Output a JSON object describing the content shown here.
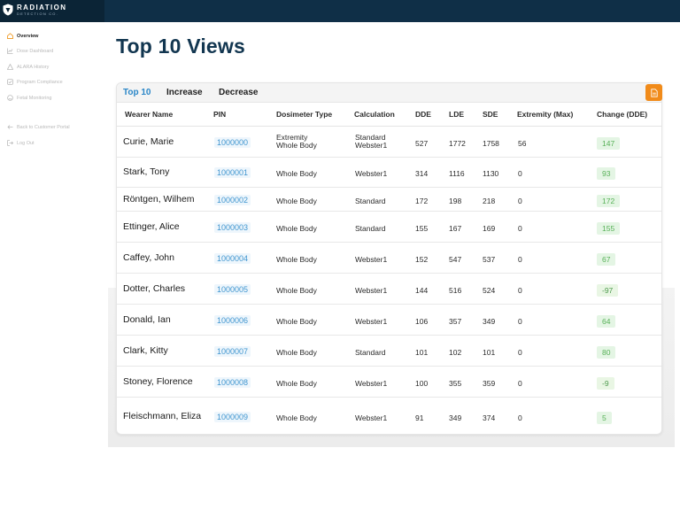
{
  "brand": {
    "line1": "RADIATION",
    "line2": "DETECTION CO."
  },
  "sidebar": {
    "items": [
      {
        "label": "Overview",
        "icon": "home-icon"
      },
      {
        "label": "Dose Dashboard",
        "icon": "chart-icon"
      },
      {
        "label": "ALARA History",
        "icon": "warning-icon"
      },
      {
        "label": "Program Compliance",
        "icon": "checklist-icon"
      },
      {
        "label": "Fetal Monitoring",
        "icon": "face-icon"
      },
      {
        "label": "Back to Customer Portal",
        "icon": "back-arrow-icon"
      },
      {
        "label": "Log Out",
        "icon": "logout-icon"
      }
    ]
  },
  "page": {
    "title": "Top 10 Views"
  },
  "tabs": [
    "Top 10",
    "Increase",
    "Decrease"
  ],
  "colors": {
    "accent": "#2a86c7",
    "export": "#f18b1a",
    "header": "#0f2f47"
  },
  "table": {
    "columns": [
      "Wearer Name",
      "PIN",
      "Dosimeter Type",
      "Calculation",
      "DDE",
      "LDE",
      "SDE",
      "Extremity (Max)",
      "Change (DDE)"
    ],
    "rows": [
      {
        "name": "Curie, Marie",
        "pin": "1000000",
        "type1": "Extremity",
        "type2": "Whole Body",
        "calc1": "Standard",
        "calc2": "Webster1",
        "dde": "527",
        "lde": "1772",
        "sde": "1758",
        "ext": "56",
        "change": "147"
      },
      {
        "name": "Stark, Tony",
        "pin": "1000001",
        "type1": "Whole Body",
        "type2": "",
        "calc1": "Webster1",
        "calc2": "",
        "dde": "314",
        "lde": "1116",
        "sde": "1130",
        "ext": "0",
        "change": "93"
      },
      {
        "name": "Röntgen, Wilhem",
        "pin": "1000002",
        "type1": "Whole Body",
        "type2": "",
        "calc1": "Standard",
        "calc2": "",
        "dde": "172",
        "lde": "198",
        "sde": "218",
        "ext": "0",
        "change": "172"
      },
      {
        "name": "Ettinger, Alice",
        "pin": "1000003",
        "type1": "Whole Body",
        "type2": "",
        "calc1": "Standard",
        "calc2": "",
        "dde": "155",
        "lde": "167",
        "sde": "169",
        "ext": "0",
        "change": "155"
      },
      {
        "name": "Caffey, John",
        "pin": "1000004",
        "type1": "Whole Body",
        "type2": "",
        "calc1": "Webster1",
        "calc2": "",
        "dde": "152",
        "lde": "547",
        "sde": "537",
        "ext": "0",
        "change": "67"
      },
      {
        "name": "Dotter, Charles",
        "pin": "1000005",
        "type1": "Whole Body",
        "type2": "",
        "calc1": "Webster1",
        "calc2": "",
        "dde": "144",
        "lde": "516",
        "sde": "524",
        "ext": "0",
        "change": "-97"
      },
      {
        "name": "Donald, Ian",
        "pin": "1000006",
        "type1": "Whole Body",
        "type2": "",
        "calc1": "Webster1",
        "calc2": "",
        "dde": "106",
        "lde": "357",
        "sde": "349",
        "ext": "0",
        "change": "64"
      },
      {
        "name": "Clark, Kitty",
        "pin": "1000007",
        "type1": "Whole Body",
        "type2": "",
        "calc1": "Standard",
        "calc2": "",
        "dde": "101",
        "lde": "102",
        "sde": "101",
        "ext": "0",
        "change": "80"
      },
      {
        "name": "Stoney, Florence",
        "pin": "1000008",
        "type1": "Whole Body",
        "type2": "",
        "calc1": "Webster1",
        "calc2": "",
        "dde": "100",
        "lde": "355",
        "sde": "359",
        "ext": "0",
        "change": "-9"
      },
      {
        "name": "Fleischmann, Eliza",
        "pin": "1000009",
        "type1": "Whole Body",
        "type2": "",
        "calc1": "Webster1",
        "calc2": "",
        "dde": "91",
        "lde": "349",
        "sde": "374",
        "ext": "0",
        "change": "5"
      }
    ]
  }
}
